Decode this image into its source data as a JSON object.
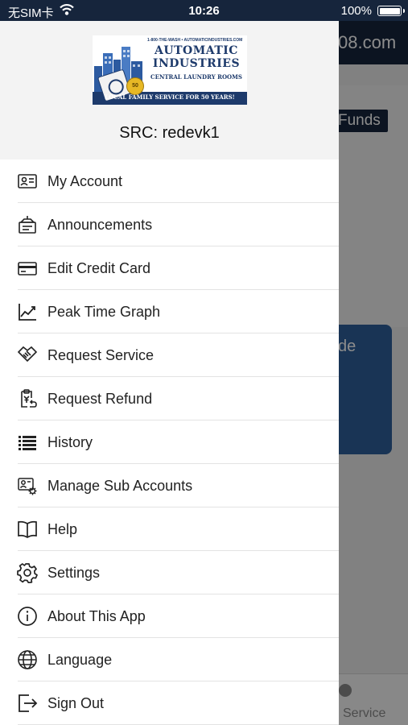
{
  "status_bar": {
    "carrier": "无SIM卡",
    "time": "10:26",
    "battery": "100%"
  },
  "background": {
    "header_fragment": "08.com",
    "funds_fragment": "Funds",
    "card_fragment": "de",
    "tab_fragment": "Service"
  },
  "drawer": {
    "logo": {
      "top_line": "1-800-THE-WASH  •  AUTOMATICINDUSTRIES.COM",
      "brand_line1": "AUTOMATIC",
      "brand_line2": "INDUSTRIES",
      "brand_line3": "CENTRAL LAUNDRY ROOMS",
      "tagline": "LOCAL FAMILY SERVICE FOR 50 YEARS!",
      "seal": "50"
    },
    "src_label": "SRC: redevk1",
    "menu": [
      {
        "label": "My Account",
        "icon": "account-card-icon"
      },
      {
        "label": "Announcements",
        "icon": "announcement-icon"
      },
      {
        "label": "Edit Credit Card",
        "icon": "credit-card-icon"
      },
      {
        "label": "Peak Time Graph",
        "icon": "chart-line-icon"
      },
      {
        "label": "Request Service",
        "icon": "handshake-icon"
      },
      {
        "label": "Request Refund",
        "icon": "refund-icon"
      },
      {
        "label": "History",
        "icon": "list-icon"
      },
      {
        "label": "Manage Sub Accounts",
        "icon": "manage-accounts-icon"
      },
      {
        "label": "Help",
        "icon": "book-icon"
      },
      {
        "label": "Settings",
        "icon": "gear-icon"
      },
      {
        "label": "About This App",
        "icon": "info-icon"
      },
      {
        "label": "Language",
        "icon": "globe-icon"
      },
      {
        "label": "Sign Out",
        "icon": "sign-out-icon"
      }
    ]
  }
}
